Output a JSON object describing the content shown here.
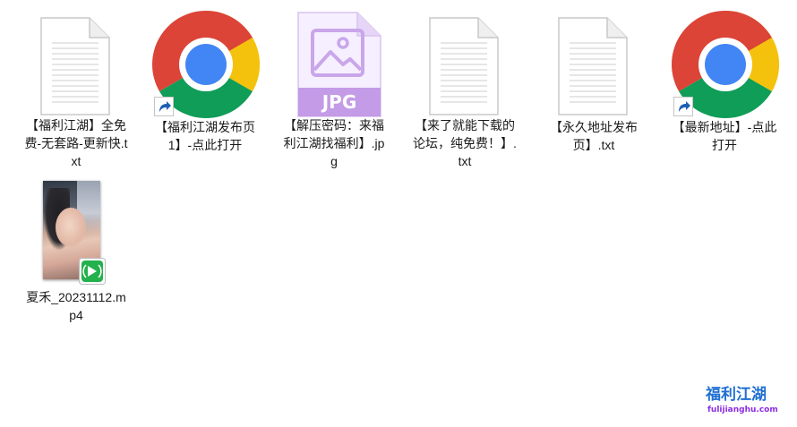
{
  "files": [
    {
      "label": "【福利江湖】全免费-无套路-更新快.txt",
      "type": "text-document-icon"
    },
    {
      "label": "【福利江湖发布页1】-点此打开",
      "type": "chrome-shortcut-icon"
    },
    {
      "label": "【解压密码：来福利江湖找福利】.jpg",
      "type": "jpg-image-icon",
      "badge": "JPG"
    },
    {
      "label": "【来了就能下载的论坛，纯免费！】.txt",
      "type": "text-document-icon"
    },
    {
      "label": "【永久地址发布页】.txt",
      "type": "text-document-icon"
    },
    {
      "label": "【最新地址】-点此打开",
      "type": "chrome-shortcut-icon"
    },
    {
      "label": "夏禾_20231112.mp4",
      "type": "video-thumbnail"
    }
  ],
  "watermark": {
    "title": "福利江湖",
    "url": "fulijianghu.com"
  },
  "colors": {
    "chrome_red": "#db4437",
    "chrome_yellow": "#f4c20d",
    "chrome_green": "#0f9d58",
    "chrome_blue": "#4285f4",
    "jpg_purple": "#b07fd8",
    "player_green": "#22b14c",
    "watermark_blue": "#1f6fd1",
    "watermark_purple": "#8a2be2"
  }
}
